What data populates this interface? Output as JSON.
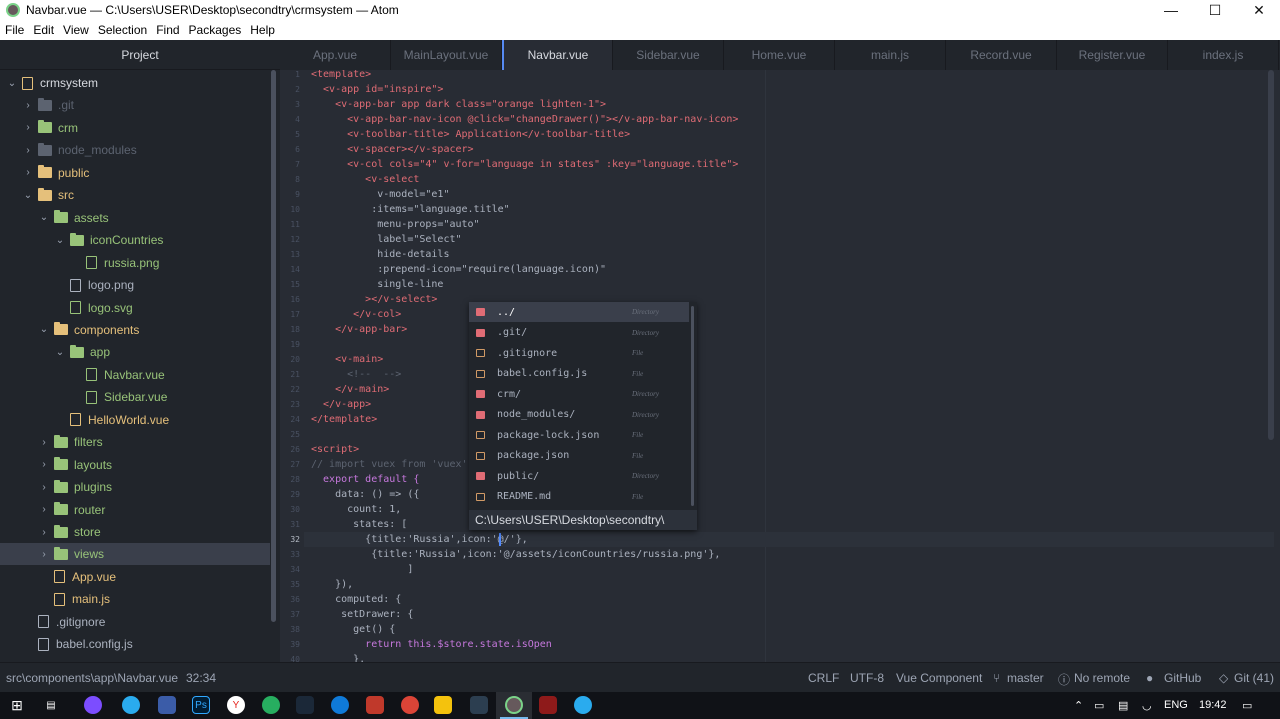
{
  "window": {
    "title": "Navbar.vue — C:\\Users\\USER\\Desktop\\secondtry\\crmsystem — Atom"
  },
  "menu": [
    "File",
    "Edit",
    "View",
    "Selection",
    "Find",
    "Packages",
    "Help"
  ],
  "tree": {
    "header": "Project",
    "items": [
      {
        "label": "crmsystem",
        "kind": "project",
        "expanded": true,
        "depth": 0
      },
      {
        "label": ".git",
        "kind": "folder",
        "expanded": false,
        "depth": 1,
        "muted": true
      },
      {
        "label": "crm",
        "kind": "folder",
        "expanded": false,
        "depth": 1,
        "color": "#98c379"
      },
      {
        "label": "node_modules",
        "kind": "folder",
        "expanded": false,
        "depth": 1,
        "muted": true
      },
      {
        "label": "public",
        "kind": "folder",
        "expanded": false,
        "depth": 1,
        "color": "#e5c07b"
      },
      {
        "label": "src",
        "kind": "folder",
        "expanded": true,
        "depth": 1,
        "color": "#e5c07b"
      },
      {
        "label": "assets",
        "kind": "folder",
        "expanded": true,
        "depth": 2,
        "color": "#98c379"
      },
      {
        "label": "iconCountries",
        "kind": "folder",
        "expanded": true,
        "depth": 3,
        "color": "#98c379"
      },
      {
        "label": "russia.png",
        "kind": "image",
        "depth": 4,
        "color": "#98c379"
      },
      {
        "label": "logo.png",
        "kind": "image",
        "depth": 3,
        "color": "#abb2bf"
      },
      {
        "label": "logo.svg",
        "kind": "image",
        "depth": 3,
        "color": "#98c379"
      },
      {
        "label": "components",
        "kind": "folder",
        "expanded": true,
        "depth": 2,
        "color": "#e5c07b"
      },
      {
        "label": "app",
        "kind": "folder",
        "expanded": true,
        "depth": 3,
        "color": "#98c379"
      },
      {
        "label": "Navbar.vue",
        "kind": "file",
        "depth": 4,
        "color": "#98c379"
      },
      {
        "label": "Sidebar.vue",
        "kind": "file",
        "depth": 4,
        "color": "#98c379"
      },
      {
        "label": "HelloWorld.vue",
        "kind": "file",
        "depth": 3,
        "color": "#e5c07b"
      },
      {
        "label": "filters",
        "kind": "folder",
        "expanded": false,
        "depth": 2,
        "color": "#98c379"
      },
      {
        "label": "layouts",
        "kind": "folder",
        "expanded": false,
        "depth": 2,
        "color": "#98c379"
      },
      {
        "label": "plugins",
        "kind": "folder",
        "expanded": false,
        "depth": 2,
        "color": "#98c379"
      },
      {
        "label": "router",
        "kind": "folder",
        "expanded": false,
        "depth": 2,
        "color": "#98c379"
      },
      {
        "label": "store",
        "kind": "folder",
        "expanded": false,
        "depth": 2,
        "color": "#98c379"
      },
      {
        "label": "views",
        "kind": "folder",
        "expanded": false,
        "depth": 2,
        "color": "#98c379",
        "selected": true
      },
      {
        "label": "App.vue",
        "kind": "file",
        "depth": 2,
        "color": "#e5c07b"
      },
      {
        "label": "main.js",
        "kind": "file",
        "depth": 2,
        "color": "#e5c07b"
      },
      {
        "label": ".gitignore",
        "kind": "file",
        "depth": 1,
        "color": "#abb2bf"
      },
      {
        "label": "babel.config.js",
        "kind": "file",
        "depth": 1,
        "color": "#abb2bf"
      }
    ]
  },
  "tabs": [
    {
      "label": "App.vue",
      "active": false
    },
    {
      "label": "MainLayout.vue",
      "active": false
    },
    {
      "label": "Navbar.vue",
      "active": true
    },
    {
      "label": "Sidebar.vue",
      "active": false
    },
    {
      "label": "Home.vue",
      "active": false
    },
    {
      "label": "main.js",
      "active": false
    },
    {
      "label": "Record.vue",
      "active": false
    },
    {
      "label": "Register.vue",
      "active": false
    },
    {
      "label": "index.js",
      "active": false
    }
  ],
  "editor": {
    "current_line": 32,
    "lines": [
      {
        "n": "1",
        "t": "<template>"
      },
      {
        "n": "2",
        "t": "  <v-app id=\"inspire\">"
      },
      {
        "n": "3",
        "t": "    <v-app-bar app dark class=\"orange lighten-1\">"
      },
      {
        "n": "4",
        "t": "      <v-app-bar-nav-icon @click=\"changeDrawer()\"></v-app-bar-nav-icon>"
      },
      {
        "n": "5",
        "t": "      <v-toolbar-title> Application</v-toolbar-title>"
      },
      {
        "n": "6",
        "t": "      <v-spacer></v-spacer>"
      },
      {
        "n": "7",
        "t": "      <v-col cols=\"4\" v-for=\"language in states\" :key=\"language.title\">"
      },
      {
        "n": "8",
        "t": "         <v-select"
      },
      {
        "n": "9",
        "t": "           v-model=\"e1\""
      },
      {
        "n": "10",
        "t": "          :items=\"language.title\""
      },
      {
        "n": "11",
        "t": "           menu-props=\"auto\""
      },
      {
        "n": "12",
        "t": "           label=\"Select\""
      },
      {
        "n": "13",
        "t": "           hide-details"
      },
      {
        "n": "14",
        "t": "           :prepend-icon=\"require(language.icon)\""
      },
      {
        "n": "15",
        "t": "           single-line"
      },
      {
        "n": "16",
        "t": "         ></v-select>"
      },
      {
        "n": "17",
        "t": "       </v-col>"
      },
      {
        "n": "18",
        "t": "    </v-app-bar>"
      },
      {
        "n": "19",
        "t": ""
      },
      {
        "n": "20",
        "t": "    <v-main>"
      },
      {
        "n": "21",
        "t": "      <!--  -->"
      },
      {
        "n": "22",
        "t": "    </v-main>"
      },
      {
        "n": "23",
        "t": "  </v-app>"
      },
      {
        "n": "24",
        "t": "</template>"
      },
      {
        "n": "25",
        "t": ""
      },
      {
        "n": "26",
        "t": "<script>"
      },
      {
        "n": "27",
        "t": "// import vuex from 'vuex'"
      },
      {
        "n": "28",
        "t": "  export default {"
      },
      {
        "n": "29",
        "t": "    data: () => ({"
      },
      {
        "n": "30",
        "t": "      count: 1,"
      },
      {
        "n": "31",
        "t": "       states: ["
      },
      {
        "n": "32",
        "t": "         {title:'Russia',icon:'@/'},"
      },
      {
        "n": "33",
        "t": "          {title:'Russia',icon:'@/assets/iconCountries/russia.png'},"
      },
      {
        "n": "34",
        "t": "                ]"
      },
      {
        "n": "35",
        "t": "    }),"
      },
      {
        "n": "36",
        "t": "    computed: {"
      },
      {
        "n": "37",
        "t": "     setDrawer: {"
      },
      {
        "n": "38",
        "t": "       get() {"
      },
      {
        "n": "39",
        "t": "         return this.$store.state.isOpen"
      },
      {
        "n": "40",
        "t": "       },"
      }
    ]
  },
  "autocomplete": {
    "items": [
      {
        "text": "../",
        "kind": "Directory",
        "type": "dir",
        "selected": true
      },
      {
        "text": ".git/",
        "kind": "Directory",
        "type": "dir"
      },
      {
        "text": ".gitignore",
        "kind": "File",
        "type": "file"
      },
      {
        "text": "babel.config.js",
        "kind": "File",
        "type": "file"
      },
      {
        "text": "crm/",
        "kind": "Directory",
        "type": "dir"
      },
      {
        "text": "node_modules/",
        "kind": "Directory",
        "type": "dir"
      },
      {
        "text": "package-lock.json",
        "kind": "File",
        "type": "file"
      },
      {
        "text": "package.json",
        "kind": "File",
        "type": "file"
      },
      {
        "text": "public/",
        "kind": "Directory",
        "type": "dir"
      },
      {
        "text": "README.md",
        "kind": "File",
        "type": "file"
      }
    ],
    "description": "C:\\Users\\USER\\Desktop\\secondtry\\"
  },
  "status": {
    "path": "src\\components\\app\\Navbar.vue",
    "cursor": "32:34",
    "line_ending": "CRLF",
    "encoding": "UTF-8",
    "grammar": "Vue Component",
    "branch": "master",
    "remote": "No remote",
    "github": "GitHub",
    "git": "Git (41)"
  },
  "taskbar": {
    "language": "ENG",
    "time": "19:42"
  }
}
